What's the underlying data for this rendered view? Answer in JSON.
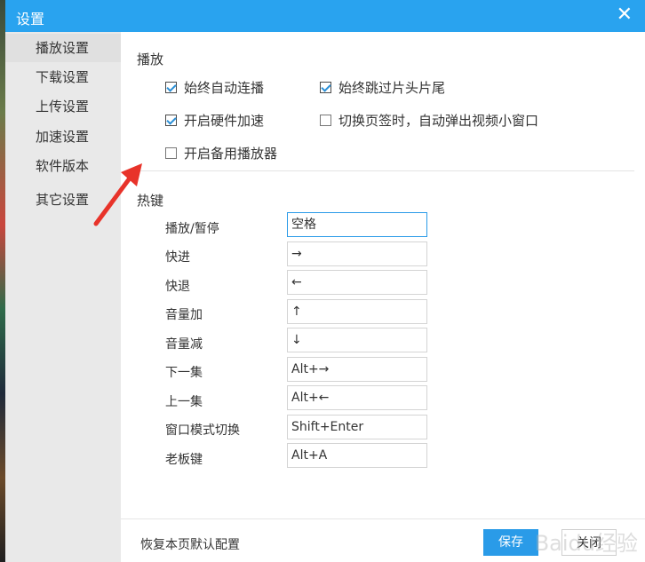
{
  "window": {
    "title": "设置",
    "close_symbol": "✕"
  },
  "sidebar": {
    "items": [
      {
        "label": "播放设置",
        "active": true
      },
      {
        "label": "下载设置"
      },
      {
        "label": "上传设置"
      },
      {
        "label": "加速设置"
      },
      {
        "label": "软件版本"
      },
      {
        "label": "其它设置"
      }
    ]
  },
  "playback": {
    "title": "播放",
    "options": [
      {
        "label": "始终自动连播",
        "checked": true
      },
      {
        "label": "始终跳过片头片尾",
        "checked": true
      },
      {
        "label": "开启硬件加速",
        "checked": true
      },
      {
        "label": "切换页签时，自动弹出视频小窗口",
        "checked": false
      },
      {
        "label": "开启备用播放器",
        "checked": false
      }
    ]
  },
  "hotkeys": {
    "title": "热键",
    "items": [
      {
        "label": "播放/暂停",
        "value": "空格"
      },
      {
        "label": "快进",
        "value": "→"
      },
      {
        "label": "快退",
        "value": "←"
      },
      {
        "label": "音量加",
        "value": "↑"
      },
      {
        "label": "音量减",
        "value": "↓"
      },
      {
        "label": "下一集",
        "value": "Alt+→"
      },
      {
        "label": "上一集",
        "value": "Alt+←"
      },
      {
        "label": "窗口模式切换",
        "value": "Shift+Enter"
      },
      {
        "label": "老板键",
        "value": "Alt+A"
      }
    ]
  },
  "footer": {
    "reset_label": "恢复本页默认配置",
    "save_label": "保存",
    "close_label": "关闭"
  },
  "watermark": "Baidu经验",
  "colors": {
    "titlebar": "#29a3ef",
    "accent": "#2a9be8",
    "annotation_arrow": "#e8332a"
  }
}
